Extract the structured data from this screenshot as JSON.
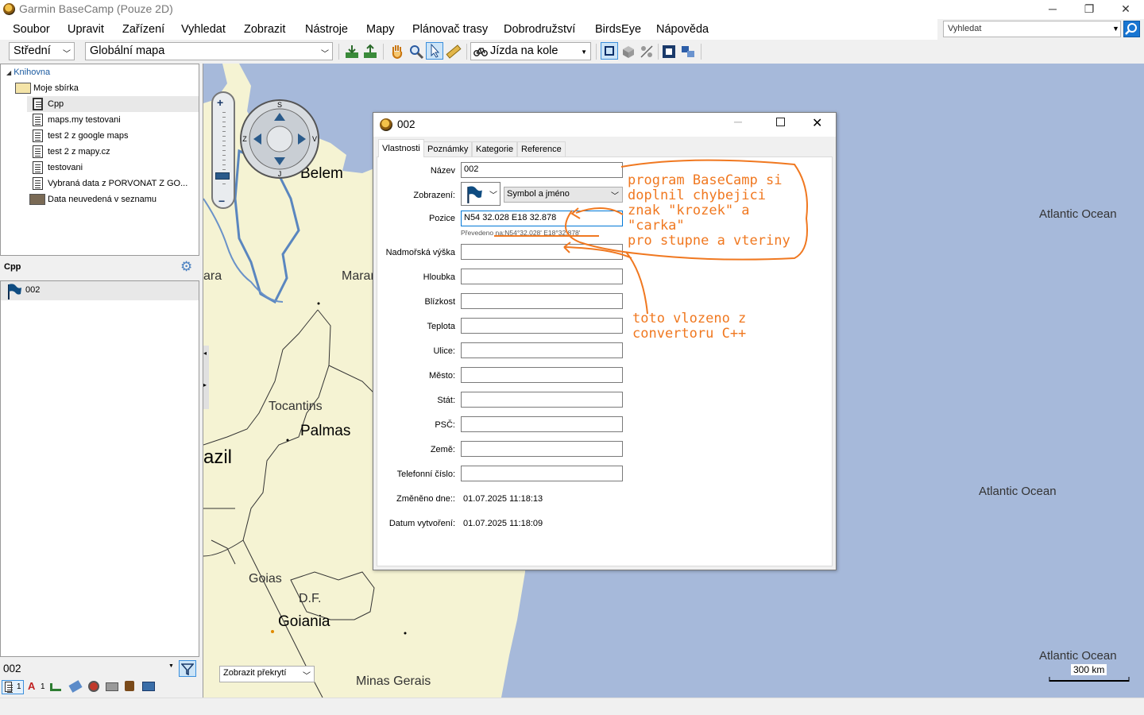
{
  "app": {
    "title": "Garmin BaseCamp (Pouze 2D)",
    "minimize": "─",
    "maximize": "❐",
    "close": "✕"
  },
  "menu": [
    "Soubor",
    "Upravit",
    "Zařízení",
    "Vyhledat",
    "Zobrazit",
    "Nástroje",
    "Mapy",
    "Plánovač trasy",
    "Dobrodružství",
    "BirdsEye",
    "Nápověda"
  ],
  "search": {
    "placeholder": "Vyhledat"
  },
  "toolbar": {
    "detail": "Střední",
    "map": "Globální mapa",
    "activity": "Jízda na kole"
  },
  "library": {
    "root": "Knihovna",
    "collection": "Moje sbírka",
    "items": [
      "Cpp",
      "maps.my testovani",
      "test 2 z google maps",
      "test 2 z mapy.cz",
      "testovani",
      "Vybraná data  z PORVONAT  Z GO...",
      "Data neuvedená  v seznamu"
    ]
  },
  "list": {
    "title": "Cpp",
    "items": [
      "002"
    ],
    "filter_value": "002",
    "count1": "1",
    "count2": "1"
  },
  "map": {
    "labels": {
      "belem": "Belem",
      "marajo": "Maran",
      "para": "ara",
      "tocantins": "Tocantins",
      "palmas": "Palmas",
      "brazil": "azil",
      "goias": "Goias",
      "df": "D.F.",
      "goiania": "Goiania",
      "minas": "Minas Gerais",
      "ocean1": "Atlantic Ocean",
      "ocean2": "Atlantic Ocean",
      "ocean3": "Atlantic Ocean"
    },
    "scale": "300 km",
    "overlay": "Zobrazit překrytí"
  },
  "dialog": {
    "title": "002",
    "tabs": [
      "Vlastnosti",
      "Poznámky",
      "Kategorie",
      "Reference"
    ],
    "fields": {
      "name_label": "Název",
      "name": "002",
      "display_label": "Zobrazení:",
      "display_value": "Symbol a jméno",
      "position_label": "Pozice",
      "position": "N54 32.028 E18 32.878",
      "converted": "Převedeno na:N54°32.028' E18°32.878'",
      "altitude": "Nadmořská výška",
      "depth": "Hloubka",
      "proximity": "Blízkost",
      "temperature": "Teplota",
      "street": "Ulice:",
      "city": "Město:",
      "state": "Stát:",
      "zip": "PSČ:",
      "country": "Země:",
      "phone": "Telefonní číslo:",
      "modified_label": "Změněno dne::",
      "modified": "01.07.2025 11:18:13",
      "created_label": "Datum vytvoření:",
      "created": "01.07.2025 11:18:09"
    }
  },
  "annotations": {
    "note1": "program BaseCamp si\ndoplnil chybejici\nznak \"krozek\" a\n\"carka\"\npro stupne a vteriny",
    "note2": "toto vlozeno z\nconvertoru C++"
  },
  "colors": {
    "ocean": "#a6b9da",
    "land": "#f5f3d3",
    "annotation": "#f07820"
  }
}
